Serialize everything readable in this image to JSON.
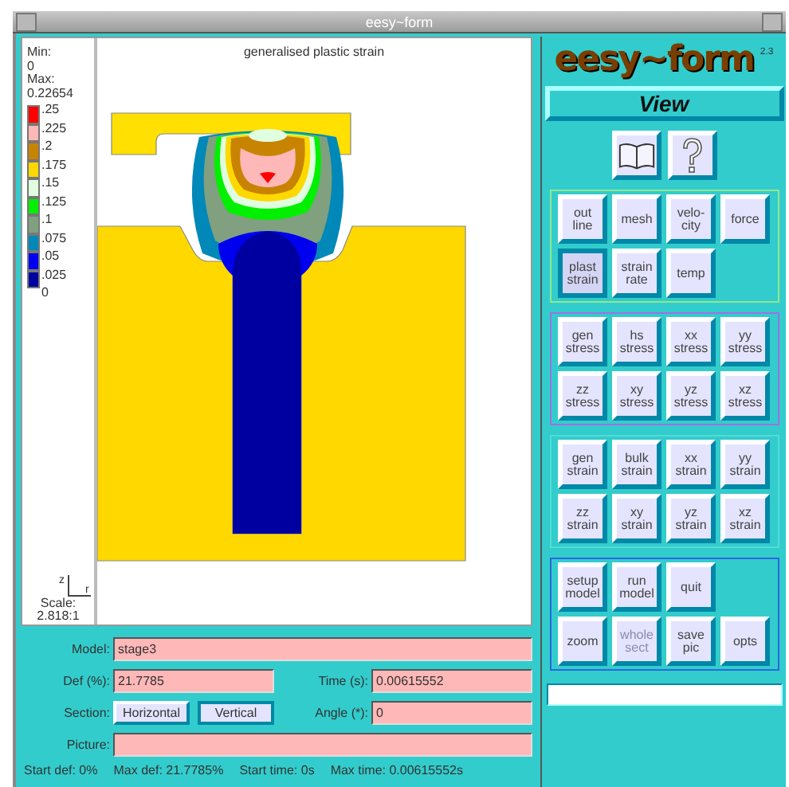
{
  "window": {
    "title": "eesy~form"
  },
  "legend": {
    "min_label": "Min:",
    "min": "0",
    "max_label": "Max:",
    "max": "0.22654",
    "entries": [
      {
        "label": ".25",
        "color": "#ff0000"
      },
      {
        "label": ".225",
        "color": "#ffb8b8"
      },
      {
        "label": ".2",
        "color": "#c88400"
      },
      {
        "label": ".175",
        "color": "#ffd800"
      },
      {
        "label": ".15",
        "color": "#e0ffe0"
      },
      {
        "label": ".125",
        "color": "#00f000"
      },
      {
        "label": ".1",
        "color": "#80a080"
      },
      {
        "label": ".075",
        "color": "#0088b8"
      },
      {
        "label": ".05",
        "color": "#0000f0"
      },
      {
        "label": ".025",
        "color": "#0000a0"
      }
    ],
    "bottom_label": "0",
    "axis_z": "z",
    "axis_r": "r",
    "scale_label": "Scale:",
    "scale": "2.818:1"
  },
  "plot": {
    "title": "generalised plastic strain"
  },
  "form": {
    "model": {
      "label": "Model:",
      "value": "stage3"
    },
    "def": {
      "label": "Def (%):",
      "value": "21.7785"
    },
    "time": {
      "label": "Time (s):",
      "value": "0.00615552"
    },
    "section": {
      "label": "Section:",
      "options": [
        {
          "label": "Horizontal",
          "selected": false
        },
        {
          "label": "Vertical",
          "selected": true
        }
      ]
    },
    "angle": {
      "label": "Angle (*):",
      "value": "0"
    },
    "picture": {
      "label": "Picture:"
    }
  },
  "status": [
    "Start def: 0%",
    "Max def: 21.7785%",
    "Start time: 0s",
    "Max time: 0.00615552s"
  ],
  "sidebar": {
    "logo": "eesy~form",
    "version": "2.3",
    "mode": "View",
    "groups": [
      {
        "color": "#90e890",
        "rows": [
          [
            {
              "label": "out\nline",
              "selected": false,
              "disabled": false
            },
            {
              "label": "mesh",
              "selected": false,
              "disabled": false
            },
            {
              "label": "velo-\ncity",
              "selected": false,
              "disabled": false
            },
            {
              "label": "force",
              "selected": false,
              "disabled": false
            }
          ],
          [
            {
              "label": "plast\nstrain",
              "selected": true,
              "disabled": false
            },
            {
              "label": "strain\nrate",
              "selected": false,
              "disabled": false
            },
            {
              "label": "temp",
              "selected": false,
              "disabled": false
            }
          ]
        ]
      },
      {
        "color": "#a070e0",
        "rows": [
          [
            {
              "label": "gen\nstress",
              "selected": false,
              "disabled": false
            },
            {
              "label": "hs\nstress",
              "selected": false,
              "disabled": false
            },
            {
              "label": "xx\nstress",
              "selected": false,
              "disabled": false
            },
            {
              "label": "yy\nstress",
              "selected": false,
              "disabled": false
            }
          ],
          [
            {
              "label": "zz\nstress",
              "selected": false,
              "disabled": false
            },
            {
              "label": "xy\nstress",
              "selected": false,
              "disabled": false
            },
            {
              "label": "yz\nstress",
              "selected": false,
              "disabled": false
            },
            {
              "label": "xz\nstress",
              "selected": false,
              "disabled": false
            }
          ]
        ]
      },
      {
        "color": "#50dcd8",
        "rows": [
          [
            {
              "label": "gen\nstrain",
              "selected": false,
              "disabled": false
            },
            {
              "label": "bulk\nstrain",
              "selected": false,
              "disabled": false
            },
            {
              "label": "xx\nstrain",
              "selected": false,
              "disabled": false
            },
            {
              "label": "yy\nstrain",
              "selected": false,
              "disabled": false
            }
          ],
          [
            {
              "label": "zz\nstrain",
              "selected": false,
              "disabled": false
            },
            {
              "label": "xy\nstrain",
              "selected": false,
              "disabled": false
            },
            {
              "label": "yz\nstrain",
              "selected": false,
              "disabled": false
            },
            {
              "label": "xz\nstrain",
              "selected": false,
              "disabled": false
            }
          ]
        ]
      },
      {
        "color": "#2868e0",
        "rows": [
          [
            {
              "label": "setup\nmodel",
              "selected": false,
              "disabled": false
            },
            {
              "label": "run\nmodel",
              "selected": false,
              "disabled": false
            },
            {
              "label": "quit",
              "selected": false,
              "disabled": false
            }
          ],
          [
            {
              "label": "zoom",
              "selected": false,
              "disabled": false
            },
            {
              "label": "whole\nsect",
              "selected": false,
              "disabled": true
            },
            {
              "label": "save\npic",
              "selected": false,
              "disabled": false
            },
            {
              "label": "opts",
              "selected": false,
              "disabled": false
            }
          ]
        ]
      }
    ]
  }
}
